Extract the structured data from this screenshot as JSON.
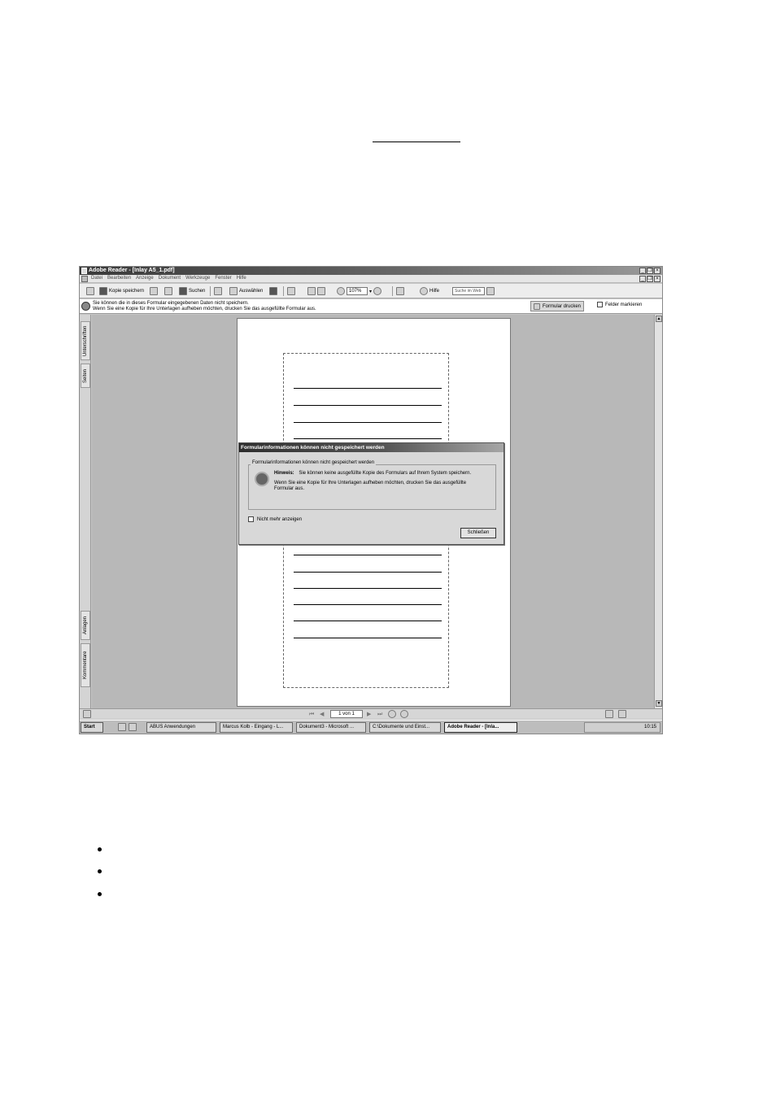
{
  "window": {
    "title": "Adobe Reader - [Inlay A5_1.pdf]",
    "controls": [
      "_",
      "❐",
      "×"
    ]
  },
  "menubar": {
    "items": [
      "Datei",
      "Bearbeiten",
      "Anzeige",
      "Dokument",
      "Werkzeuge",
      "Fenster",
      "Hilfe"
    ]
  },
  "toolbar": {
    "save_copy_label": "Kopie speichern",
    "search_label": "Suchen",
    "select_label": "Auswählen",
    "zoom_value": "107%",
    "help_label": "Hilfe",
    "web_search_placeholder": "Suche im Web"
  },
  "infobar": {
    "message_line1": "Sie können die in dieses Formular eingegebenen Daten nicht speichern.",
    "message_line2": "Wenn Sie eine Kopie für Ihre Unterlagen aufheben möchten, drucken Sie das ausgefüllte Formular aus.",
    "print_button": "Formular drucken",
    "highlight_fields": "Felder markieren"
  },
  "side_tabs": [
    "Unterschriften",
    "Seiten",
    "Anlagen",
    "Kommentare"
  ],
  "status": {
    "page_indicator": "1 von 1"
  },
  "taskbar": {
    "start": "Start",
    "tasks": [
      "ABUS Anwendungen",
      "Marcus Kolb - Eingang - L...",
      "Dokument3 - Microsoft ...",
      "C:\\Dokumente und Einst...",
      "Adobe Reader - [Inla..."
    ],
    "clock": "10:15"
  },
  "dialog": {
    "title": "Formularinformationen können nicht gespeichert werden",
    "group_label": "Formularinformationen können nicht gespeichert werden",
    "hint_label": "Hinweis:",
    "hint_text": "Sie können keine ausgefüllte Kopie des Formulars auf Ihrem System speichern.",
    "body_text": "Wenn Sie eine Kopie für Ihre Unterlagen aufheben möchten, drucken Sie das ausgefüllte Formular aus.",
    "dont_show_again": "Nicht mehr anzeigen",
    "close_button": "Schließen"
  }
}
